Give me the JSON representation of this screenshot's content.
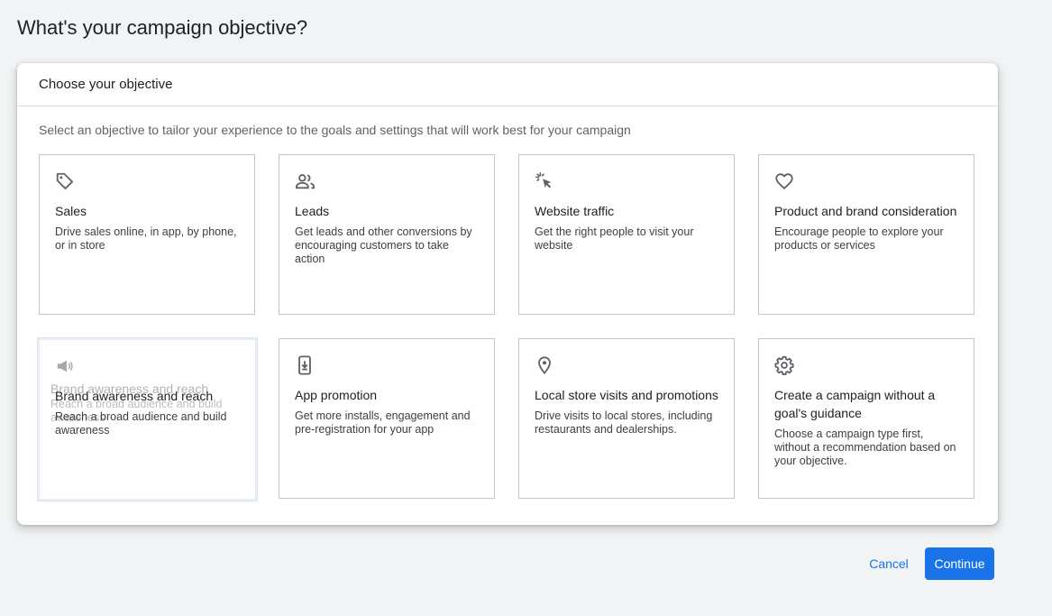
{
  "page": {
    "title": "What's your campaign objective?"
  },
  "card": {
    "header": "Choose your objective",
    "subtitle": "Select an objective to tailor your experience to the goals and settings that will work best for your campaign"
  },
  "objectives": [
    {
      "icon": "tag-icon",
      "title": "Sales",
      "description": "Drive sales online, in app, by phone, or in store"
    },
    {
      "icon": "people-icon",
      "title": "Leads",
      "description": "Get leads and other conversions by encouraging customers to take action"
    },
    {
      "icon": "cursor-click-icon",
      "title": "Website traffic",
      "description": "Get the right people to visit your website"
    },
    {
      "icon": "heart-icon",
      "title": "Product and brand consideration",
      "description": "Encourage people to explore your products or services"
    },
    {
      "icon": "megaphone-icon",
      "title": "Brand awareness and reach",
      "description": "Reach a broad audience and build awareness"
    },
    {
      "icon": "phone-download-icon",
      "title": "App promotion",
      "description": "Get more installs, engagement and pre-registration for your app"
    },
    {
      "icon": "location-pin-icon",
      "title": "Local store visits and promotions",
      "description": "Drive visits to local stores, including restaurants and dealerships."
    },
    {
      "icon": "gear-icon",
      "title": "Create a campaign without a goal's guidance",
      "description": "Choose a campaign type first, without a recommendation based on your objective."
    }
  ],
  "actions": {
    "cancel": "Cancel",
    "continue": "Continue"
  }
}
